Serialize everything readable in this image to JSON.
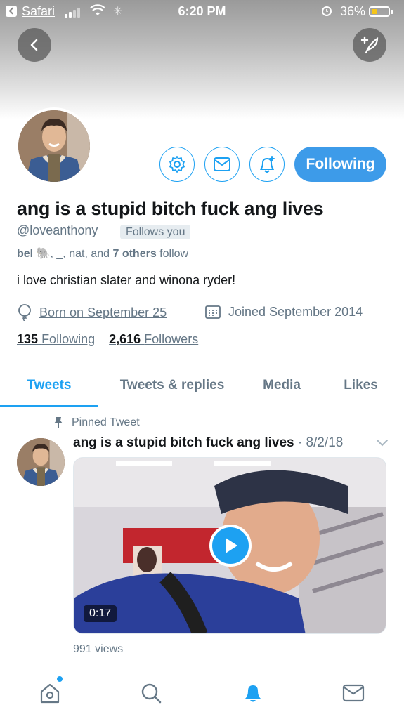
{
  "status_bar": {
    "app_back_label": "Safari",
    "time": "6:20 PM",
    "battery_percent": "36%",
    "battery_level": 0.36
  },
  "colors": {
    "accent": "#1da1f2",
    "following_button": "#3d9be9",
    "secondary_text": "#657786"
  },
  "header": {
    "back_icon": "chevron-left-icon",
    "compose_icon": "feather-plus-icon"
  },
  "profile": {
    "display_name": "ang is a stupid bitch fuck ang lives",
    "handle": "@loveanthony",
    "follows_you_badge": "Follows you",
    "mutuals": {
      "prefix": "bel",
      "emoji": "🐘",
      "sep": ", _, ",
      "name2": "nat",
      "middle": ", and ",
      "others": "7 others",
      "suffix": " follow"
    },
    "bio": "i love christian slater and winona ryder!",
    "birthday": "Born on September 25",
    "joined": "Joined September 2014",
    "following_count": "135",
    "following_label": "Following",
    "followers_count": "2,616",
    "followers_label": "Followers",
    "following_button_label": "Following"
  },
  "tabs": [
    {
      "label": "Tweets",
      "active": true
    },
    {
      "label": "Tweets & replies",
      "active": false
    },
    {
      "label": "Media",
      "active": false
    },
    {
      "label": "Likes",
      "active": false
    }
  ],
  "pinned_tweet": {
    "pinned_label": "Pinned Tweet",
    "author": "ang is a stupid bitch fuck ang lives",
    "date": "· 8/2/18",
    "video_duration": "0:17",
    "views": "991 views"
  },
  "bottom_nav": {
    "items": [
      "home-icon",
      "search-icon",
      "notifications-icon",
      "messages-icon"
    ],
    "active": "notifications-icon"
  }
}
